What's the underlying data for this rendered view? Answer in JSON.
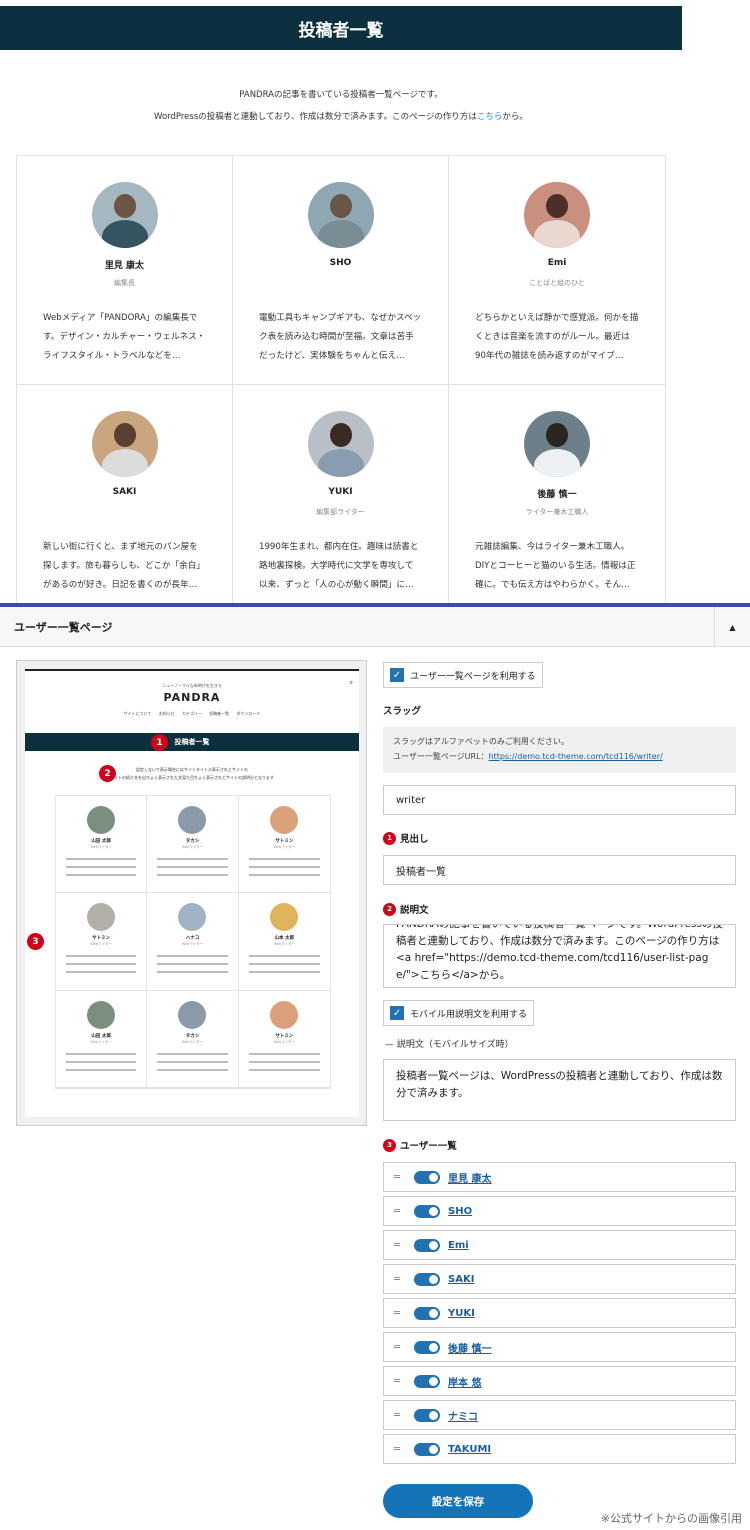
{
  "header": {
    "title": "投稿者一覧"
  },
  "intro": {
    "line1": "PANDRAの記事を書いている投稿者一覧ページです。",
    "line2_prefix": "WordPressの投稿者と連動しており、作成は数分で済みます。このページの作り方は",
    "line2_link": "こちら",
    "line2_suffix": "から。"
  },
  "authors": [
    {
      "name": "里見 康太",
      "role": "編集長",
      "desc": "Webメディア「PANDORA」の編集長です。デザイン・カルチャー・ウェルネス・ライフスタイル・トラベルなどを…"
    },
    {
      "name": "SHO",
      "role": "",
      "desc": "電動工具もキャンプギアも、なぜかスペック表を読み込む時間が至福。文章は苦手だったけど、実体験をちゃんと伝え…"
    },
    {
      "name": "Emi",
      "role": "ことばと絵のひと",
      "desc": "どちらかといえば静かで感覚派。何かを描くときは音楽を流すのがルール。最近は90年代の雑誌を読み返すのがマイブ…"
    },
    {
      "name": "SAKI",
      "role": "",
      "desc": "新しい街に行くと、まず地元のパン屋を探します。旅も暮らしも、どこか「余白」があるのが好き。日記を書くのが長年…"
    },
    {
      "name": "YUKI",
      "role": "編集部ライター",
      "desc": "1990年生まれ、都内在住。趣味は読書と路地裏探検。大学時代に文学を専攻して以来、ずっと「人の心が動く瞬間」に…"
    },
    {
      "name": "後藤 慎一",
      "role": "ライター兼木工職人",
      "desc": "元雑誌編集、今はライター兼木工職人。DIYとコーヒーと猫のいる生活。情報は正確に。でも伝え方はやわらかく。そん…"
    }
  ],
  "panel": {
    "title": "ユーザー一覧ページ",
    "toggle_icon": "▲"
  },
  "preview": {
    "tagline": "ニューノーマルな新時代を生きる",
    "logo": "PANDRA",
    "nav": "サイトについて お知らせ カテゴリー 投稿者一覧 ダウンロード",
    "bar_title": "投稿者一覧",
    "desc1": "設定しないで表示場合にはサイトタイトル表示されとサイトの",
    "desc2": "サイトの紹介文を自ちょく表示された文見た目ちょく表示されとサイトの説明分となります",
    "search_icon": "⌕",
    "cards": [
      {
        "name": "山田 太郎",
        "role": "Webライター"
      },
      {
        "name": "タカシ",
        "role": "Webライター"
      },
      {
        "name": "サトミン",
        "role": "Webライター"
      },
      {
        "name": "サトミン",
        "role": "Webライター"
      },
      {
        "name": "ハナコ",
        "role": "Webライター"
      },
      {
        "name": "山本 太郎",
        "role": "Webライター"
      },
      {
        "name": "山田 太郎",
        "role": "Webライター"
      },
      {
        "name": "タカシ",
        "role": "Webライター"
      },
      {
        "name": "サトミン",
        "role": "Webライター"
      }
    ]
  },
  "badges": {
    "b1": "1",
    "b2": "2",
    "b3": "3"
  },
  "form": {
    "use_page_label": "ユーザー一覧ページを利用する",
    "slug_label": "スラッグ",
    "slug_note1": "スラッグはアルファベットのみご利用ください。",
    "slug_note2_prefix": "ユーザー一覧ページURL：",
    "slug_note2_link": "https://demo.tcd-theme.com/tcd116/writer/",
    "slug_value": "writer",
    "heading_label": "見出し",
    "heading_value": "投稿者一覧",
    "desc_label": "説明文",
    "desc_value": "PANDRAの記事を書いている投稿者一覧ページです。WordPressの投稿者と連動しており、作成は数分で済みます。このページの作り方は<a href=\"https://demo.tcd-theme.com/tcd116/user-list-page/\">こちら</a>から。",
    "mobile_label": "モバイル用説明文を利用する",
    "mobile_sub_label": "説明文（モバイルサイズ時）",
    "mobile_value": "投稿者一覧ページは、WordPressの投稿者と連動しており、作成は数分で済みます。",
    "users_label": "ユーザー一覧",
    "users": [
      "里見 康太",
      "SHO",
      "Emi",
      "SAKI",
      "YUKI",
      "後藤 慎一",
      "岸本 悠",
      "ナミコ",
      "TAKUMI"
    ],
    "save_label": "設定を保存",
    "check_icon": "✓",
    "grip_icon": "═"
  },
  "credit": "※公式サイトからの画像引用"
}
